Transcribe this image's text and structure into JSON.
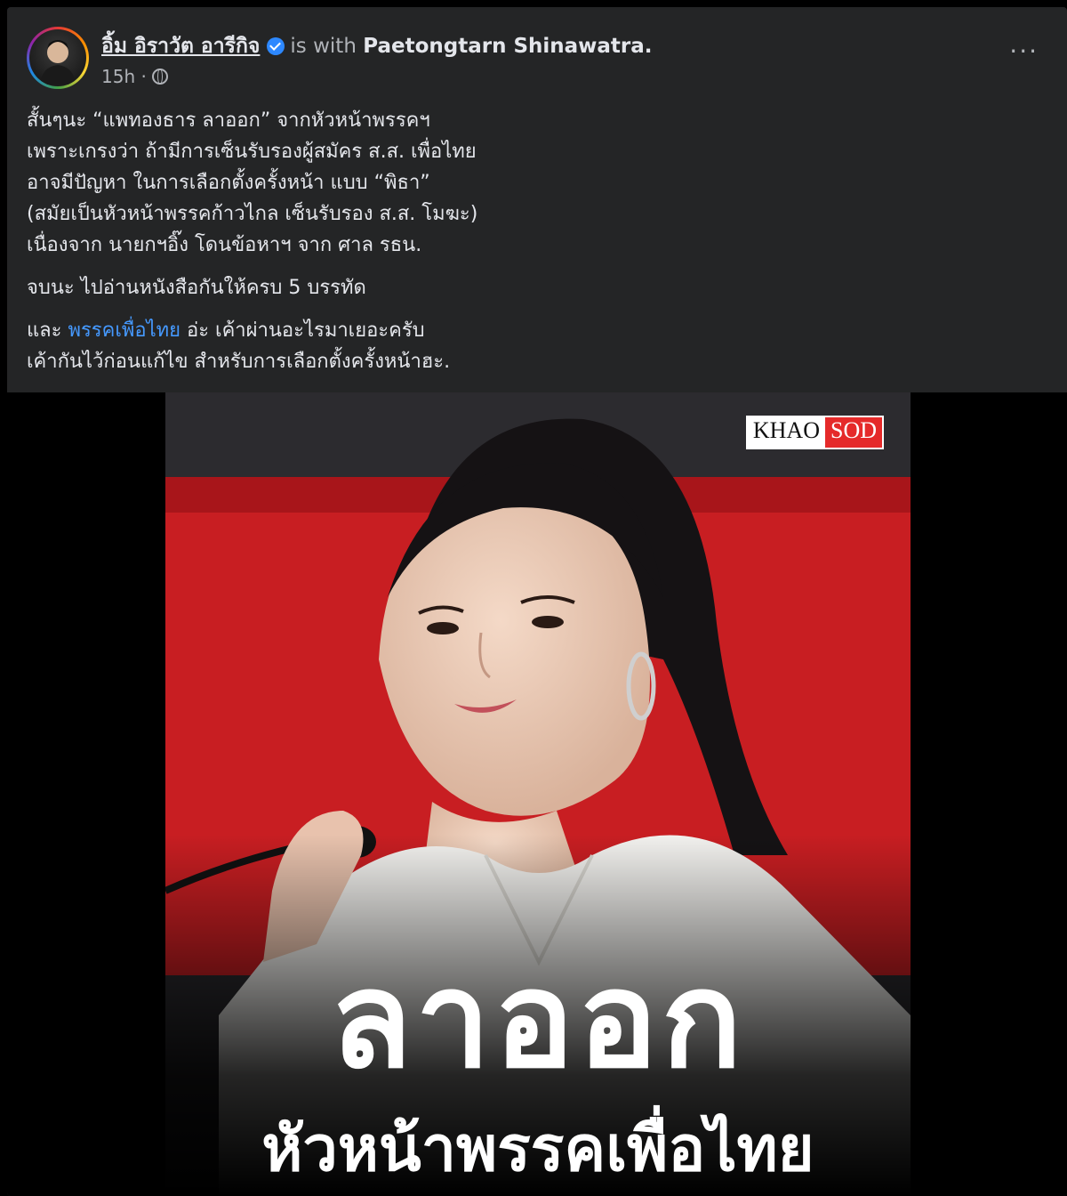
{
  "post": {
    "author": "อิ้ม อิราวัต อารีกิจ",
    "with_text": "is with",
    "tagged": "Paetongtarn Shinawatra.",
    "time": "15h ·",
    "more": "···",
    "lines": [
      "สั้นๆนะ “แพทองธาร ลาออก” จากหัวหน้าพรรคฯ",
      "เพราะเกรงว่า ถ้ามีการเซ็นรับรองผู้สมัคร ส.ส. เพื่อไทย",
      "อาจมีปัญหา ในการเลือกตั้งครั้งหน้า แบบ “พิธา”",
      "(สมัยเป็นหัวหน้าพรรคก้าวไกล เซ็นรับรอง ส.ส. โมฆะ)",
      "เนื่องจาก นายกฯอิ๊ง โดนข้อหาฯ จาก ศาล รธน."
    ],
    "para2": "จบนะ ไปอ่านหนังสือกันให้ครบ 5 บรรทัด",
    "para3_prefix": "และ ",
    "para3_link": "พรรคเพื่อไทย",
    "para3_suffix": " อ่ะ เค้าผ่านอะไรมาเยอะครับ",
    "para3_line2": "เค้ากันไว้ก่อนแก้ไข สำหรับการเลือกตั้งครั้งหน้าฮะ."
  },
  "image": {
    "brand_left": "KHAO",
    "brand_right": "SOD",
    "headline": "ลาออก",
    "subhead": "หัวหน้าพรรคเพื่อไทย"
  },
  "colors": {
    "background": "#242526",
    "link": "#4599ff",
    "verified": "#2d88ff",
    "brand_red": "#e52a2a"
  }
}
